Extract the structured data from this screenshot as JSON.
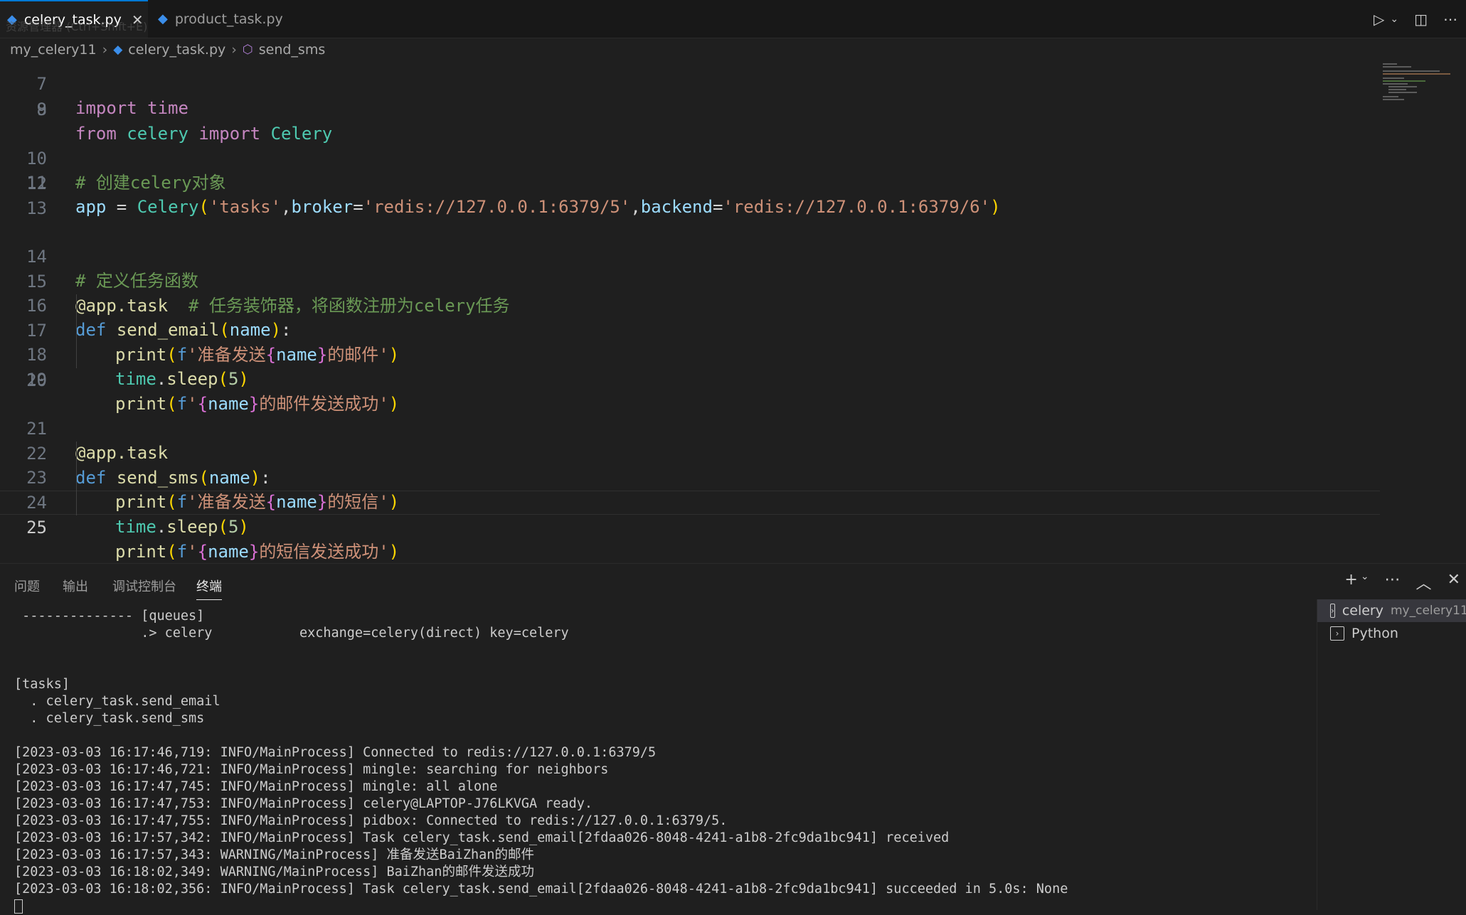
{
  "tabs": [
    {
      "label": "celery_task.py",
      "close": "✕"
    },
    {
      "label": "product_task.py"
    }
  ],
  "ghost_text": "资源管理器 (Ctrl+Shift+E)",
  "breadcrumb": {
    "folder": "my_celery11",
    "file": "celery_task.py",
    "symbol": "send_sms"
  },
  "editor": {
    "partial_top_line": "import time",
    "line_numbers": [
      "7",
      "8",
      "9",
      "10",
      "11",
      "12",
      "13",
      "14",
      "15",
      "16",
      "17",
      "18",
      "19",
      "20",
      "21",
      "22",
      "23",
      "24",
      "25"
    ]
  },
  "code": {
    "l8": {
      "from": "from",
      "mod": "celery",
      "imp": "import",
      "cls": "Celery"
    },
    "l10": "# 创建celery对象",
    "l11": {
      "app": "app",
      "eq": " = ",
      "cls": "Celery",
      "p1": "(",
      "s1": "'tasks'",
      "c1": ",",
      "k1": "broker",
      "e1": "=",
      "s2": "'redis://127.0.0.1:6379/5'",
      "c2": ",",
      "k2": "backend",
      "e2": "=",
      "s3": "'redis://127.0.0.1:6379/6'",
      "p2": ")"
    },
    "l14": "# 定义任务函数",
    "l15": {
      "dec": "@app.task",
      "cm": "  # 任务装饰器，将函数注册为celery任务"
    },
    "l16": {
      "def": "def",
      "fn": "send_email",
      "p1": "(",
      "arg": "name",
      "p2": ")",
      "colon": ":"
    },
    "l17": {
      "fn": "print",
      "p1": "(",
      "f": "f",
      "s1": "'准备发送",
      "b1": "{",
      "v": "name",
      "b2": "}",
      "s2": "的邮件'",
      "p2": ")"
    },
    "l18": {
      "mod": "time",
      "dot": ".",
      "fn": "sleep",
      "p1": "(",
      "num": "5",
      "p2": ")"
    },
    "l19": {
      "fn": "print",
      "p1": "(",
      "f": "f",
      "s1": "'",
      "b1": "{",
      "v": "name",
      "b2": "}",
      "s2": "的邮件发送成功'",
      "p2": ")"
    },
    "l21": {
      "dec": "@app.task"
    },
    "l22": {
      "def": "def",
      "fn": "send_sms",
      "p1": "(",
      "arg": "name",
      "p2": ")",
      "colon": ":"
    },
    "l23": {
      "fn": "print",
      "p1": "(",
      "f": "f",
      "s1": "'准备发送",
      "b1": "{",
      "v": "name",
      "b2": "}",
      "s2": "的短信'",
      "p2": ")"
    },
    "l24": {
      "mod": "time",
      "dot": ".",
      "fn": "sleep",
      "p1": "(",
      "num": "5",
      "p2": ")"
    },
    "l25": {
      "fn": "print",
      "p1": "(",
      "f": "f",
      "s1": "'",
      "b1": "{",
      "v": "name",
      "b2": "}",
      "s2": "的短信发送成功'",
      "p2": ")"
    }
  },
  "panel": {
    "tabs": [
      "问题",
      "输出",
      "调试控制台",
      "终端"
    ],
    "terminal_lines": [
      " -------------- [queues]",
      "                .> celery           exchange=celery(direct) key=celery",
      "",
      "",
      "[tasks]",
      "  . celery_task.send_email",
      "  . celery_task.send_sms",
      "",
      "[2023-03-03 16:17:46,719: INFO/MainProcess] Connected to redis://127.0.0.1:6379/5",
      "[2023-03-03 16:17:46,721: INFO/MainProcess] mingle: searching for neighbors",
      "[2023-03-03 16:17:47,745: INFO/MainProcess] mingle: all alone",
      "[2023-03-03 16:17:47,753: INFO/MainProcess] celery@LAPTOP-J76LKVGA ready.",
      "[2023-03-03 16:17:47,755: INFO/MainProcess] pidbox: Connected to redis://127.0.0.1:6379/5.",
      "[2023-03-03 16:17:57,342: INFO/MainProcess] Task celery_task.send_email[2fdaa026-8048-4241-a1b8-2fc9da1bc941] received",
      "[2023-03-03 16:17:57,343: WARNING/MainProcess] 准备发送BaiZhan的邮件",
      "[2023-03-03 16:18:02,349: WARNING/MainProcess] BaiZhan的邮件发送成功",
      "[2023-03-03 16:18:02,356: INFO/MainProcess] Task celery_task.send_email[2fdaa026-8048-4241-a1b8-2fc9da1bc941] succeeded in 5.0s: None"
    ],
    "terminals": [
      {
        "name": "celery",
        "cwd": "my_celery11"
      },
      {
        "name": "Python"
      }
    ]
  },
  "icons": {
    "run": "play-icon",
    "split": "split-editor-icon",
    "more": "more-icon",
    "add": "plus-icon",
    "maximize": "chevron-up-icon",
    "close": "close-icon"
  }
}
